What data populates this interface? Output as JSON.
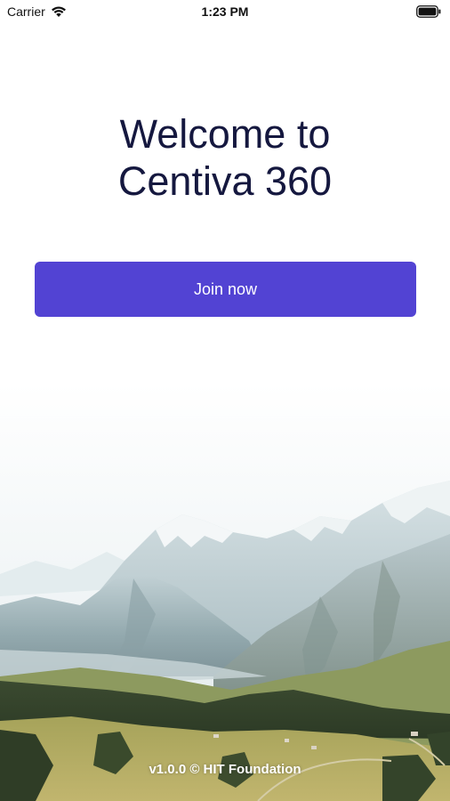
{
  "status_bar": {
    "carrier": "Carrier",
    "time": "1:23 PM",
    "wifi_icon": "wifi-icon",
    "battery_icon": "battery-icon"
  },
  "welcome": {
    "line1": "Welcome to",
    "line2": "Centiva 360"
  },
  "join_button": {
    "label": "Join now"
  },
  "footer": {
    "text": "v1.0.0 © HIT Foundation"
  },
  "colors": {
    "accent": "#5243d3",
    "title": "#15183f",
    "background": "#ffffff"
  }
}
